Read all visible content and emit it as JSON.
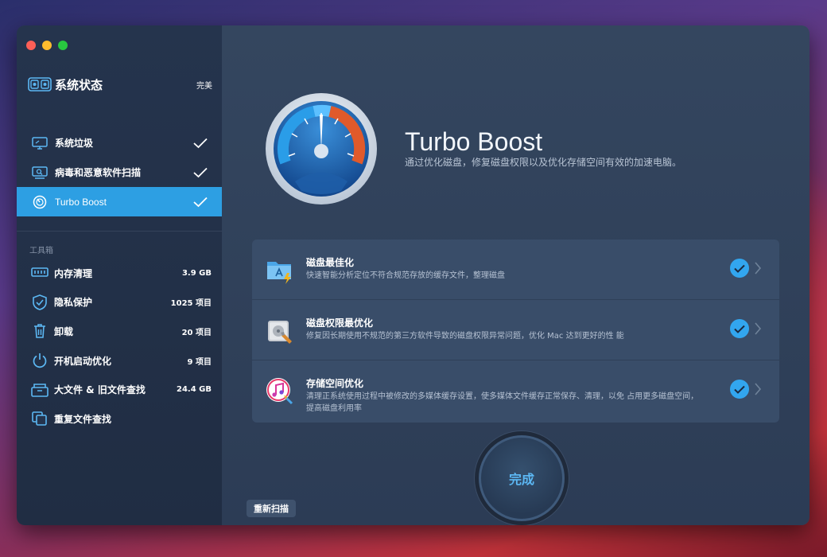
{
  "app": {
    "window_title": ""
  },
  "status": {
    "title": "系统状态",
    "value": "完美",
    "icon": "monitor-status-icon"
  },
  "nav": [
    {
      "label": "系统垃圾",
      "icon": "monitor-icon",
      "done": true,
      "active": false
    },
    {
      "label": "病毒和恶意软件扫描",
      "icon": "scan-icon",
      "done": true,
      "active": false
    },
    {
      "label": "Turbo Boost",
      "icon": "speedometer-icon",
      "done": true,
      "active": true
    }
  ],
  "toolbox": {
    "label": "工具箱",
    "items": [
      {
        "label": "内存清理",
        "value": "3.9 GB",
        "icon": "memory-icon"
      },
      {
        "label": "隐私保护",
        "value": "1025 项目",
        "icon": "shield-icon"
      },
      {
        "label": "卸载",
        "value": "20 项目",
        "icon": "trash-icon"
      },
      {
        "label": "开机启动优化",
        "value": "9 项目",
        "icon": "power-icon"
      },
      {
        "label": "大文件 & 旧文件查找",
        "value": "24.4 GB",
        "icon": "box-icon"
      },
      {
        "label": "重复文件查找",
        "value": "",
        "icon": "duplicate-icon"
      }
    ]
  },
  "hero": {
    "title": "Turbo Boost",
    "subtitle": "通过优化磁盘，修复磁盘权限以及优化存储空间有效的加速电脑。"
  },
  "cards": [
    {
      "title": "磁盘最佳化",
      "desc": "快速智能分析定位不符合规范存放的缓存文件，整理磁盘",
      "icon": "folder-app-icon"
    },
    {
      "title": "磁盘权限最优化",
      "desc": "修复因长期使用不规范的第三方软件导致的磁盘权限异常问题，优化 Mac 达到更好的性 能",
      "icon": "disk-utility-icon"
    },
    {
      "title": "存储空间优化",
      "desc": "清理正系统使用过程中被修改的多媒体缓存设置，使多媒体文件缓存正常保存、清理，以免 占用更多磁盘空间，提高磁盘利用率",
      "icon": "music-icon"
    }
  ],
  "actions": {
    "done_label": "完成",
    "rescan_label": "重新扫描"
  },
  "colors": {
    "accent": "#2d9fe3",
    "check": "#32a6ef",
    "sidebar": "#25344d",
    "main": "#34465f"
  }
}
